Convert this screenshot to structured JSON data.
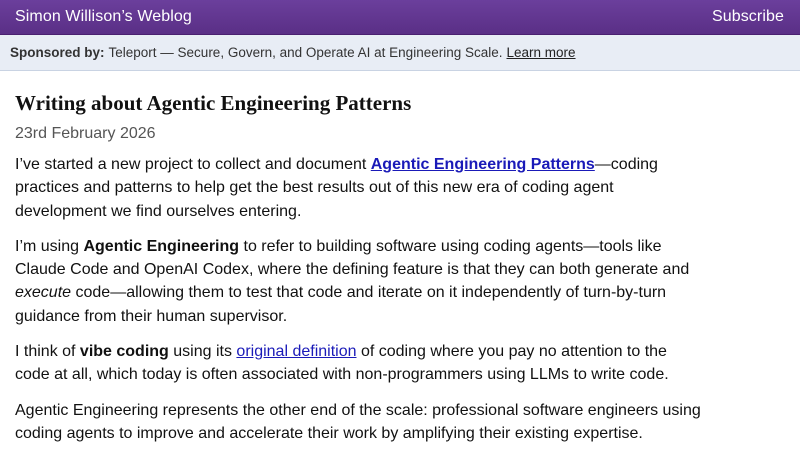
{
  "header": {
    "site_title": "Simon Willison’s Weblog",
    "subscribe": "Subscribe"
  },
  "sponsor": {
    "label": "Sponsored by:",
    "text": "Teleport — Secure, Govern, and Operate AI at Engineering Scale.",
    "link": "Learn more"
  },
  "article": {
    "title": "Writing about Agentic Engineering Patterns",
    "date": "23rd February 2026",
    "p1": {
      "before": "I’ve started a new project to collect and document ",
      "link": "Agentic Engineering Patterns",
      "after": "—coding practices and patterns to help get the best results out of this new era of coding agent development we find ourselves entering."
    },
    "p2": {
      "before": "I’m using ",
      "bold": "Agentic Engineering",
      "middle": " to refer to building software using coding agents—tools like Claude Code and OpenAI Codex, where the defining feature is that they can both generate and ",
      "italic": "execute",
      "after": " code—allowing them to test that code and iterate on it independently of turn-by-turn guidance from their human supervisor."
    },
    "p3": {
      "before": "I think of ",
      "bold": "vibe coding",
      "middle": " using its ",
      "link": "original definition",
      "after": " of coding where you pay no attention to the code at all, which today is often associated with non-programmers using LLMs to write code."
    },
    "p4": {
      "text": "Agentic Engineering represents the other end of the scale: professional software engineers using coding agents to improve and accelerate their work by amplifying their existing expertise."
    }
  },
  "colors": {
    "header_bg": "#5f348f",
    "sponsor_bg": "#e8edf5",
    "link": "#1a1ab8"
  }
}
